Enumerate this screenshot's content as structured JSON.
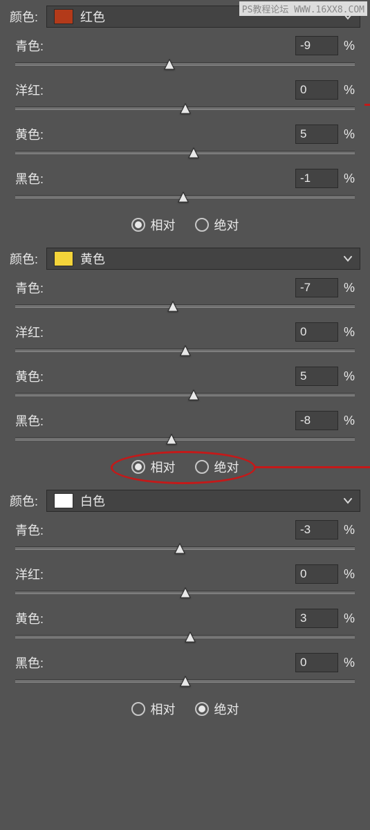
{
  "watermark": "PS教程论坛 WWW.16XX8.COM",
  "labels": {
    "color": "颜色:",
    "cyan": "青色:",
    "magenta": "洋红:",
    "yellow": "黄色:",
    "black": "黑色:",
    "percent": "%",
    "relative": "相对",
    "absolute": "绝对"
  },
  "groups": [
    {
      "selector": {
        "name": "红色",
        "swatch": "#b33a1a"
      },
      "sliders": {
        "cyan": -9,
        "magenta": 0,
        "yellow": 5,
        "black": -1
      },
      "mode": "relative",
      "annotated": false
    },
    {
      "selector": {
        "name": "黄色",
        "swatch": "#f4d43a"
      },
      "sliders": {
        "cyan": -7,
        "magenta": 0,
        "yellow": 5,
        "black": -8
      },
      "mode": "relative",
      "annotated": true
    },
    {
      "selector": {
        "name": "白色",
        "swatch": "#ffffff"
      },
      "sliders": {
        "cyan": -3,
        "magenta": 0,
        "yellow": 3,
        "black": 0
      },
      "mode": "absolute",
      "annotated": false
    }
  ]
}
